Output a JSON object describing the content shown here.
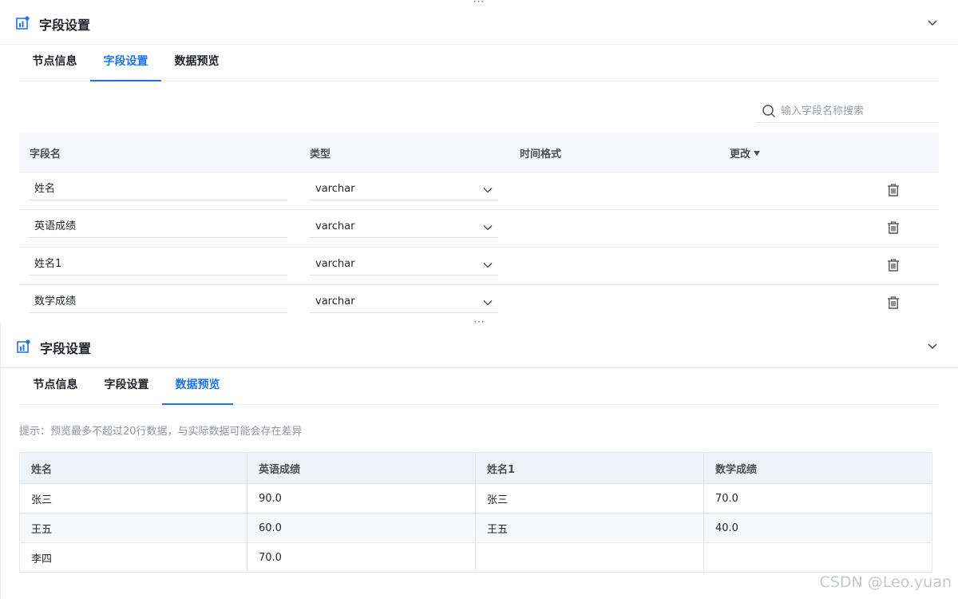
{
  "top_panel": {
    "drag_handle": "···",
    "title": "字段设置",
    "tabs": [
      {
        "label": "节点信息"
      },
      {
        "label": "字段设置"
      },
      {
        "label": "数据预览"
      }
    ],
    "search": {
      "placeholder": "输入字段名称搜索",
      "value": ""
    },
    "columns": {
      "name": "字段名",
      "type": "类型",
      "time_format": "时间格式",
      "change": "更改"
    },
    "rows": [
      {
        "name": "姓名",
        "type": "varchar"
      },
      {
        "name": "英语成绩",
        "type": "varchar"
      },
      {
        "name": "姓名1",
        "type": "varchar"
      },
      {
        "name": "数学成绩",
        "type": "varchar"
      }
    ]
  },
  "bottom_panel": {
    "drag_handle": "···",
    "title": "字段设置",
    "tabs": [
      {
        "label": "节点信息"
      },
      {
        "label": "字段设置"
      },
      {
        "label": "数据预览"
      }
    ],
    "hint": "提示：预览最多不超过20行数据，与实际数据可能会存在差异",
    "columns": [
      "姓名",
      "英语成绩",
      "姓名1",
      "数学成绩"
    ],
    "rows": [
      [
        "张三",
        "90.0",
        "张三",
        "70.0"
      ],
      [
        "王五",
        "60.0",
        "王五",
        "40.0"
      ],
      [
        "李四",
        "70.0",
        "",
        ""
      ]
    ]
  },
  "watermark": "CSDN @Leo.yuan",
  "colors": {
    "accent": "#1f74ec",
    "header_bg": "#f5f7fa",
    "border": "#e3e6eb"
  },
  "icons": {
    "panel": "node-settings-icon",
    "collapse": "chevron-down-icon",
    "search": "search-icon",
    "dropdown": "chevron-down-icon",
    "delete": "trash-icon"
  }
}
